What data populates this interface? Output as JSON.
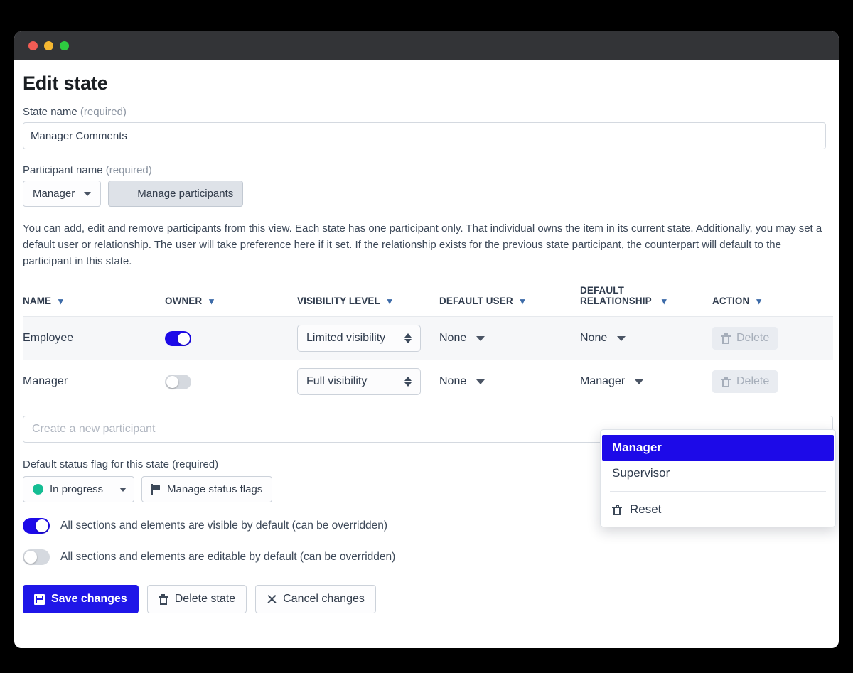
{
  "window": {
    "traffic_lights": [
      "close-red",
      "minimize-yellow",
      "maximize-green"
    ]
  },
  "page": {
    "title": "Edit state"
  },
  "state_name": {
    "label": "State name",
    "required_tag": "(required)",
    "value": "Manager Comments",
    "placeholder": ""
  },
  "participant_name": {
    "label": "Participant name",
    "required_tag": "(required)",
    "selected": "Manager",
    "manage_button": "Manage participants"
  },
  "description": "You can add, edit and remove participants from this view. Each state has one participant only. That individual owns the item in its current state. Additionally, you may set a default user or relationship. The user will take preference here if it set. If the relationship exists for the previous state participant, the counterpart will default to the participant in this state.",
  "table": {
    "columns": [
      {
        "label": "NAME",
        "sortable": true
      },
      {
        "label": "OWNER",
        "sortable": true
      },
      {
        "label": "VISIBILITY LEVEL",
        "sortable": true
      },
      {
        "label": "DEFAULT USER",
        "sortable": true
      },
      {
        "label": "DEFAULT RELATIONSHIP",
        "sortable": true
      },
      {
        "label": "ACTION",
        "sortable": true
      }
    ],
    "rows": [
      {
        "name": "Employee",
        "owner_on": true,
        "visibility": "Limited visibility",
        "default_user": "None",
        "default_relationship": "None",
        "action": "Delete"
      },
      {
        "name": "Manager",
        "owner_on": false,
        "visibility": "Full visibility",
        "default_user": "None",
        "default_relationship": "Manager",
        "action": "Delete"
      }
    ]
  },
  "relationship_dropdown": {
    "options": [
      "Manager",
      "Supervisor"
    ],
    "selected": "Manager",
    "reset_label": "Reset"
  },
  "create_participant": {
    "placeholder": "Create a new participant",
    "value": ""
  },
  "status_flag": {
    "label": "Default status flag for this state",
    "required_tag": "(required)",
    "selected": "In progress",
    "dot_color": "#14bd93",
    "manage_button": "Manage status flags"
  },
  "toggles": [
    {
      "label": "All sections and elements are visible by default (can be overridden)",
      "on": true
    },
    {
      "label": "All sections and elements are editable by default (can be overridden)",
      "on": false
    }
  ],
  "footer": {
    "save": "Save changes",
    "delete": "Delete state",
    "cancel": "Cancel changes"
  },
  "colors": {
    "accent_blue": "#1d0ae8",
    "status_green": "#14bd93",
    "titlebar": "#333437"
  }
}
